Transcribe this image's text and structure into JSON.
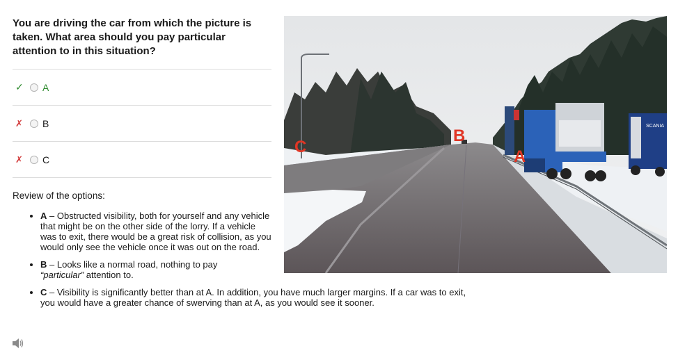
{
  "question": "You are driving the car from which the picture is taken. What area should you pay particular attention to in this situation?",
  "options": [
    {
      "mark": "✓",
      "status": "correct",
      "label": "A"
    },
    {
      "mark": "✗",
      "status": "wrong",
      "label": "B"
    },
    {
      "mark": "✗",
      "status": "wrong",
      "label": "C"
    }
  ],
  "review": {
    "title": "Review of the options:",
    "items": [
      {
        "key": "A",
        "dash": " – ",
        "text": "Obstructed visibility, both for yourself and any vehicle that might be on the other side of the lorry. If a vehicle was to exit, there would be a great risk of collision, as you would only see the vehicle once it was out on the road."
      },
      {
        "key": "B",
        "dash": " – ",
        "text_before": "Looks like a normal road, nothing to pay ",
        "emph": "“particular”",
        "text_after": " attention to."
      },
      {
        "key": "C",
        "dash": " – ",
        "text": "Visibility is significantly better than at A. In addition, you have much larger margins. If a car was to exit, you would have a greater chance of swerving than at A, as you would see it sooner."
      }
    ]
  },
  "image": {
    "markers": [
      "A",
      "B",
      "C"
    ],
    "truck_sign": "SCANIA"
  },
  "audio_icon": "speaker-icon",
  "colors": {
    "correct": "#2e8b2e",
    "wrong": "#d23a3a",
    "marker": "#e03524"
  }
}
